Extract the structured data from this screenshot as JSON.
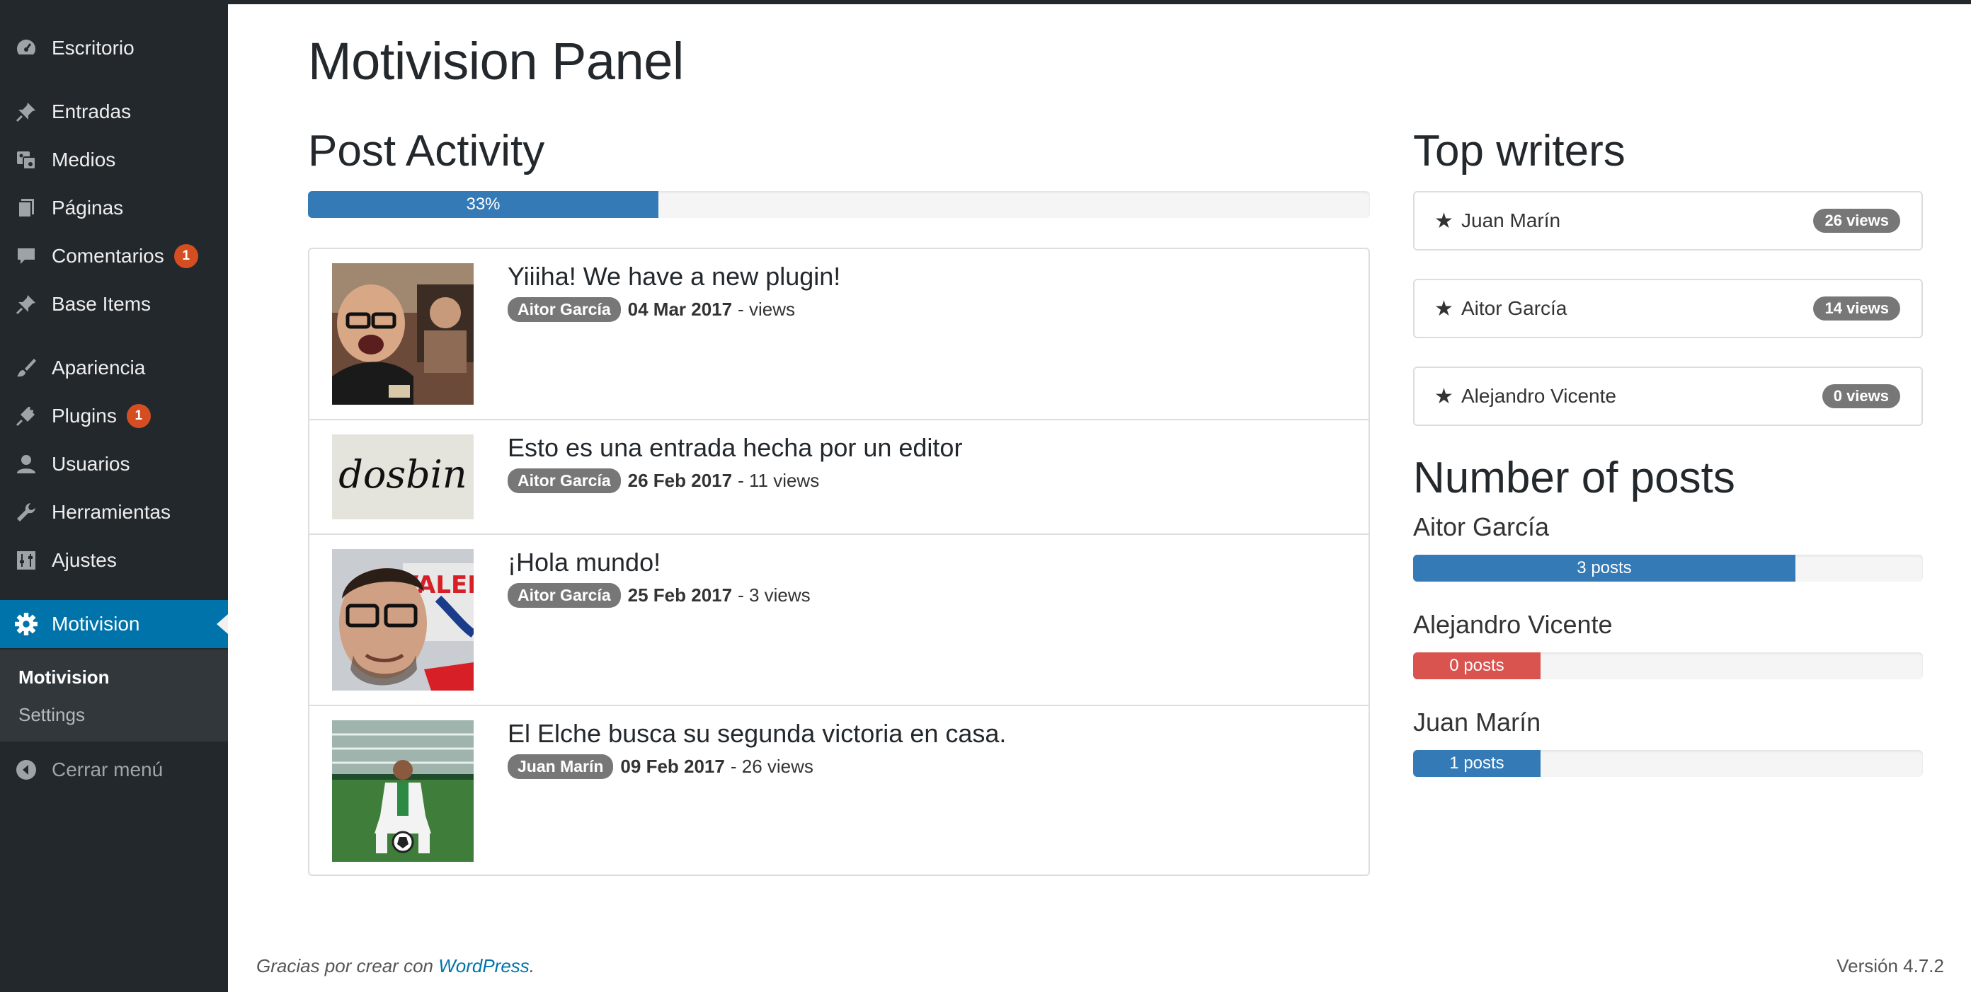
{
  "menu": {
    "items": [
      {
        "label": "Escritorio",
        "icon": "dashboard-icon"
      },
      {
        "label": "Entradas",
        "icon": "pin-icon"
      },
      {
        "label": "Medios",
        "icon": "media-icon"
      },
      {
        "label": "Páginas",
        "icon": "pages-icon"
      },
      {
        "label": "Comentarios",
        "icon": "comment-icon",
        "badge": "1"
      },
      {
        "label": "Base Items",
        "icon": "pin-icon"
      },
      {
        "label": "Apariencia",
        "icon": "brush-icon"
      },
      {
        "label": "Plugins",
        "icon": "plugin-icon",
        "badge": "1"
      },
      {
        "label": "Usuarios",
        "icon": "user-icon"
      },
      {
        "label": "Herramientas",
        "icon": "wrench-icon"
      },
      {
        "label": "Ajustes",
        "icon": "settings-sliders-icon"
      },
      {
        "label": "Motivision",
        "icon": "gear-icon",
        "active": true
      }
    ],
    "submenu": [
      {
        "label": "Motivision",
        "current": true
      },
      {
        "label": "Settings"
      }
    ],
    "collapse_label": "Cerrar menú"
  },
  "page": {
    "title": "Motivision Panel"
  },
  "post_activity": {
    "title": "Post Activity",
    "progress_label": "33%",
    "progress_value": 33,
    "posts": [
      {
        "title": "Yiiiha! We have a new plugin!",
        "author": "Aitor García",
        "date": "04 Mar 2017",
        "views": "- views",
        "thumb": "person-selfie"
      },
      {
        "title": "Esto es una entrada hecha por un editor",
        "author": "Aitor García",
        "date": "26 Feb 2017",
        "views": "- 11 views",
        "thumb": "dosbin-logo"
      },
      {
        "title": "¡Hola mundo!",
        "author": "Aitor García",
        "date": "25 Feb 2017",
        "views": "- 3 views",
        "thumb": "person-portrait"
      },
      {
        "title": "El Elche busca su segunda victoria en casa.",
        "author": "Juan Marín",
        "date": "09 Feb 2017",
        "views": "- 26 views",
        "thumb": "football-player"
      }
    ],
    "thumb_text": "dosbin",
    "thumb_sign": "VALEN"
  },
  "top_writers": {
    "title": "Top writers",
    "writers": [
      {
        "name": "Juan Marín",
        "views": "26 views"
      },
      {
        "name": "Aitor García",
        "views": "14 views"
      },
      {
        "name": "Alejandro Vicente",
        "views": "0 views"
      }
    ]
  },
  "number_of_posts": {
    "title": "Number of posts",
    "authors": [
      {
        "name": "Aitor García",
        "label": "3 posts",
        "fraction": 0.75,
        "color": "#337ab7"
      },
      {
        "name": "Alejandro Vicente",
        "label": "0 posts",
        "fraction": 0.25,
        "color": "#d9534f"
      },
      {
        "name": "Juan Marín",
        "label": "1 posts",
        "fraction": 0.25,
        "color": "#337ab7"
      }
    ]
  },
  "footer": {
    "thanks_prefix": "Gracias por crear con",
    "thanks_link": "WordPress",
    "thanks_suffix": ".",
    "version": "Versión 4.7.2"
  },
  "colors": {
    "sidebar_bg": "#23282d",
    "active_bg": "#0073aa",
    "bar_blue": "#337ab7",
    "bar_red": "#d9534f",
    "label_gray": "#777777"
  }
}
